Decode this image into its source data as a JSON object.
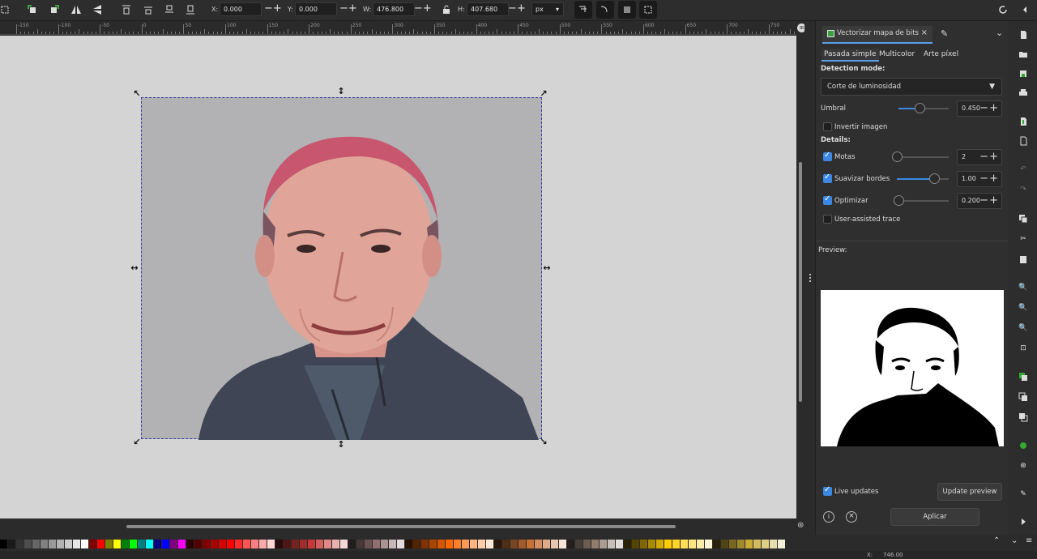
{
  "toolbar": {
    "x_label": "X:",
    "x_value": "0.000",
    "y_label": "Y:",
    "y_value": "0.000",
    "w_label": "W:",
    "w_value": "476.800",
    "h_label": "H:",
    "h_value": "407.680",
    "unit": "px"
  },
  "ruler": {
    "labels": [
      "-150",
      "-100",
      "-50",
      "0",
      "50",
      "100",
      "150",
      "200",
      "250",
      "300",
      "350",
      "400",
      "450",
      "500",
      "550",
      "600",
      "650",
      "700",
      "750"
    ]
  },
  "dialog": {
    "tab_title": "Vectorizar mapa de bits",
    "tabs": [
      "Pasada simple",
      "Multicolor",
      "Arte píxel"
    ],
    "detection_mode_label": "Detection mode:",
    "detection_mode_value": "Corte de luminosidad",
    "threshold_label": "Umbral",
    "threshold_value": "0.450",
    "threshold_level": 0.45,
    "invert_label": "Invertir imagen",
    "invert_checked": false,
    "details_label": "Details:",
    "speckles_label": "Motas",
    "speckles_value": "2",
    "speckles_checked": true,
    "smooth_label": "Suavizar bordes",
    "smooth_value": "1.00",
    "smooth_checked": true,
    "optimize_label": "Optimizar",
    "optimize_value": "0.200",
    "optimize_checked": true,
    "assisted_label": "User-assisted trace",
    "assisted_checked": false,
    "preview_label": "Preview:",
    "live_updates_label": "Live updates",
    "live_updates_checked": true,
    "update_preview_label": "Update preview",
    "apply_label": "Aplicar"
  },
  "status": {
    "x_label": "X:",
    "x_value": "746.00"
  },
  "palette_colors": [
    "#000000",
    "#1a1a1a",
    "#333333",
    "#4d4d4d",
    "#666666",
    "#808080",
    "#999999",
    "#b3b3b3",
    "#cccccc",
    "#e6e6e6",
    "#ffffff",
    "#800000",
    "#ff0000",
    "#808000",
    "#ffff00",
    "#008000",
    "#00ff00",
    "#008080",
    "#00ffff",
    "#000080",
    "#0000ff",
    "#800080",
    "#ff00ff",
    "#2b0000",
    "#550000",
    "#800000",
    "#aa0000",
    "#d40000",
    "#ff0000",
    "#ff2a2a",
    "#ff5555",
    "#ff8080",
    "#ffaaaa",
    "#ffd5d5",
    "#280b0b",
    "#501616",
    "#782121",
    "#a02c2c",
    "#c83737",
    "#d35f5f",
    "#de8787",
    "#e9afaf",
    "#f4d7d7",
    "#241c1c",
    "#483737",
    "#6c5353",
    "#916f6f",
    "#ac9393",
    "#c8b7b7",
    "#e3dbdb",
    "#2b1100",
    "#552200",
    "#803300",
    "#aa4400",
    "#d45500",
    "#ff6600",
    "#ff7f2a",
    "#ff9955",
    "#ffb380",
    "#ffccaa",
    "#ffe6d5",
    "#28170b",
    "#502d16",
    "#784421",
    "#a05a2c",
    "#c87137",
    "#d38d5f",
    "#deaa87",
    "#e9c6af",
    "#f4e3d7",
    "#241f1c",
    "#483e37",
    "#6c5d53",
    "#917c6f",
    "#ac9d93",
    "#c8beb7",
    "#e3dedb",
    "#2b2200",
    "#554400",
    "#806600",
    "#aa8800",
    "#d4aa00",
    "#ffcc00",
    "#ffd42a",
    "#ffdd55",
    "#ffe680",
    "#ffeeaa",
    "#fff6d5",
    "#28220b",
    "#504416",
    "#786721",
    "#a0892c",
    "#c8ab37",
    "#d3bc5f",
    "#decd87",
    "#e9ddaf",
    "#f4eed7"
  ]
}
